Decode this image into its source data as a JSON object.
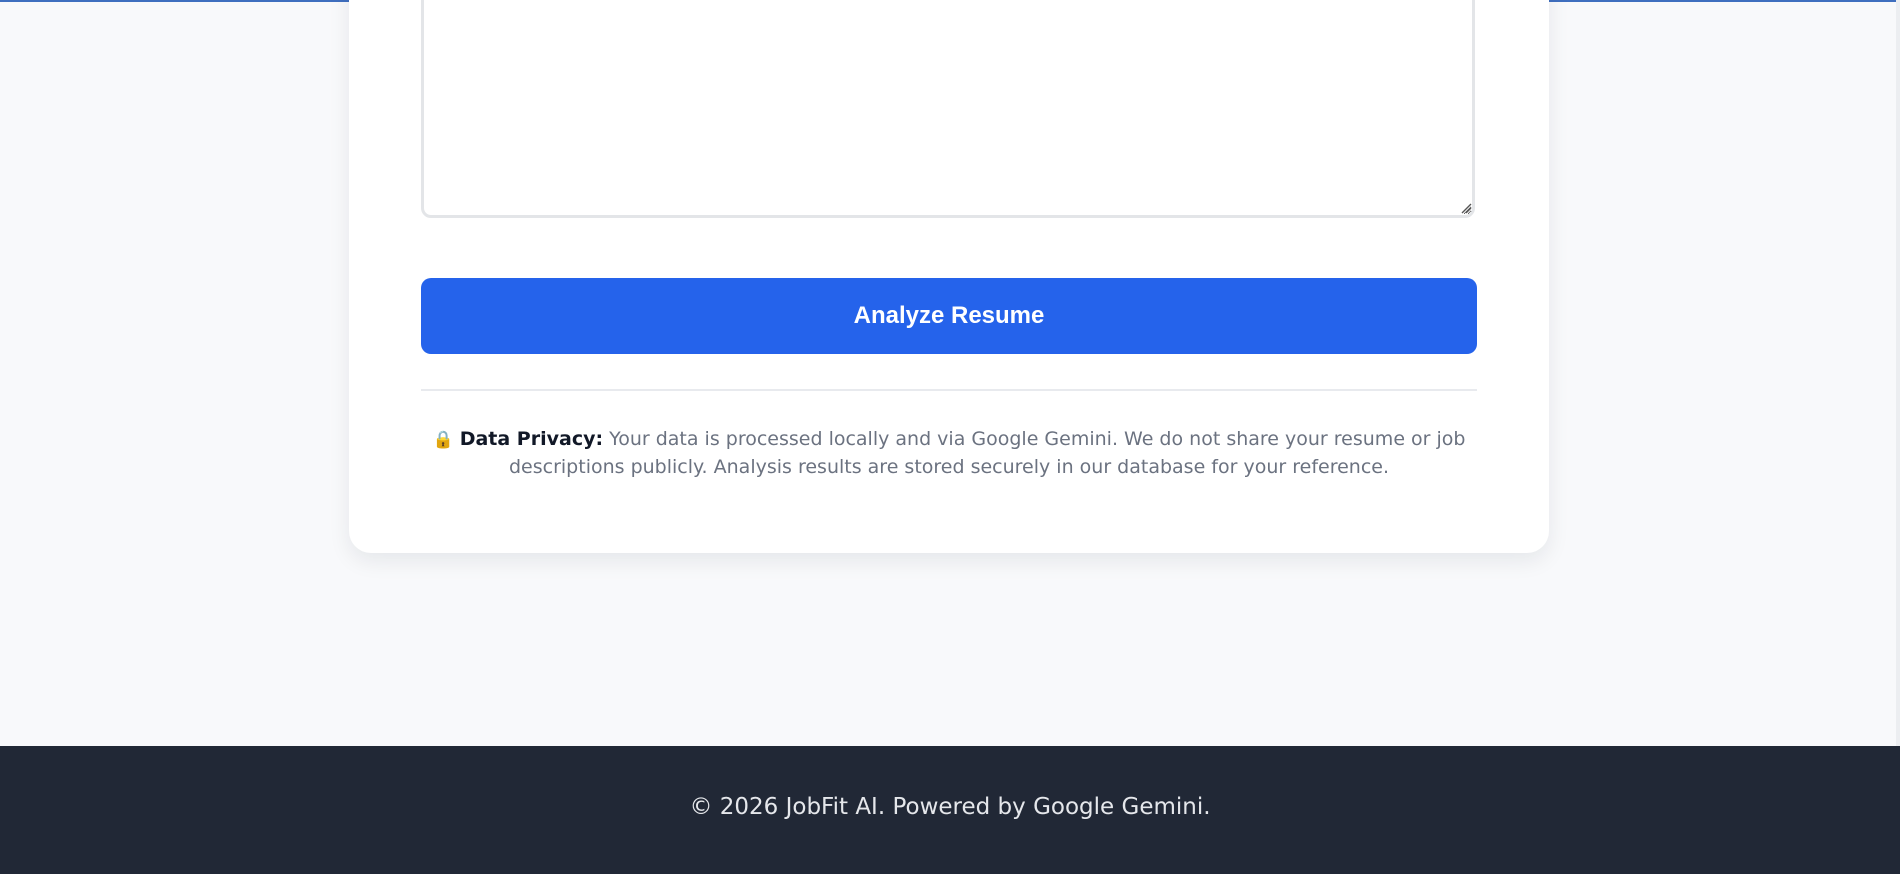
{
  "form": {
    "textarea_value": "",
    "analyze_label": "Analyze Resume"
  },
  "privacy": {
    "lock_icon": "🔒",
    "label": "Data Privacy:",
    "text": "Your data is processed locally and via Google Gemini. We do not share your resume or job descriptions publicly. Analysis results are stored securely in our database for your reference."
  },
  "footer": {
    "text": "© 2026 JobFit AI. Powered by Google Gemini."
  },
  "colors": {
    "accent": "#2563eb",
    "footer_bg": "#212836",
    "page_bg": "#f8f9fb"
  }
}
